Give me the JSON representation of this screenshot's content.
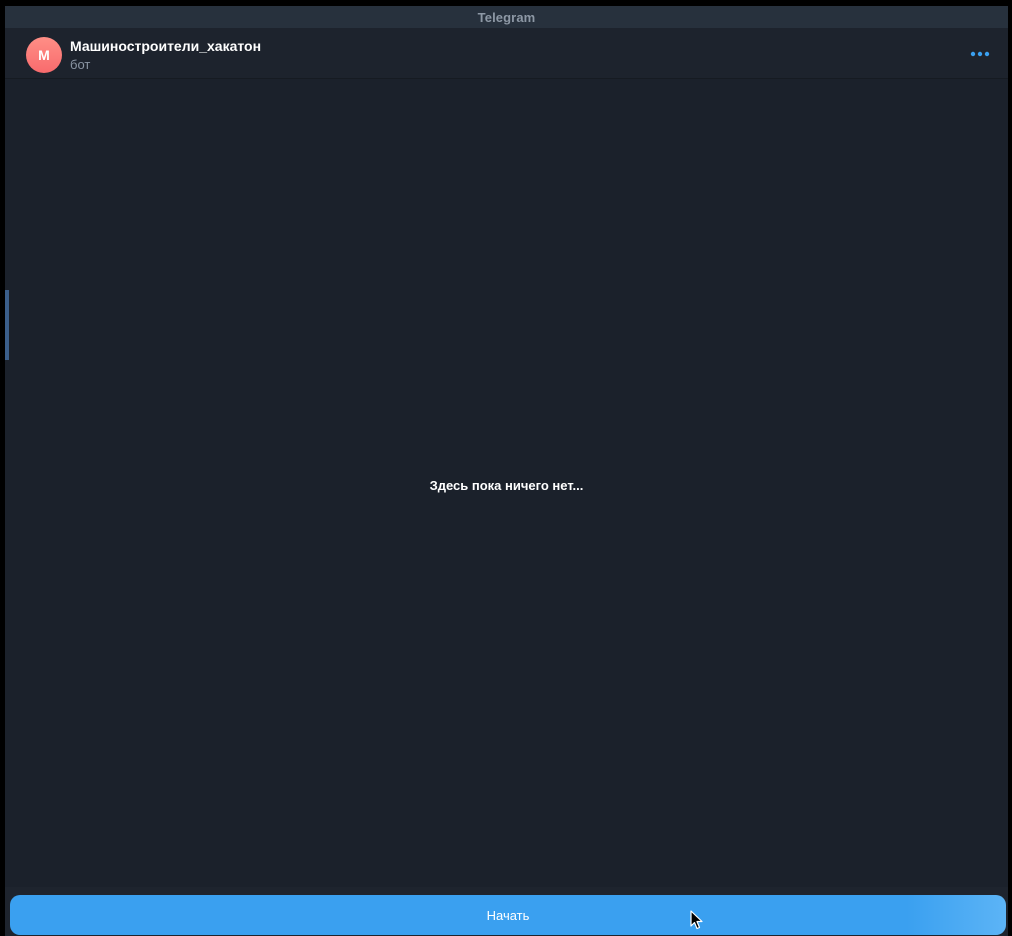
{
  "window": {
    "title": "Telegram"
  },
  "chat": {
    "avatar_letter": "М",
    "title": "Машиностроители_хакатон",
    "subtitle": "бот",
    "more_icon": "more-horizontal-icon"
  },
  "messages": {
    "empty_text": "Здесь пока ничего нет..."
  },
  "bottom": {
    "start_label": "Начать"
  },
  "colors": {
    "accent": "#3aa0f0",
    "background": "#1b212b",
    "avatar": "#f97a78"
  }
}
